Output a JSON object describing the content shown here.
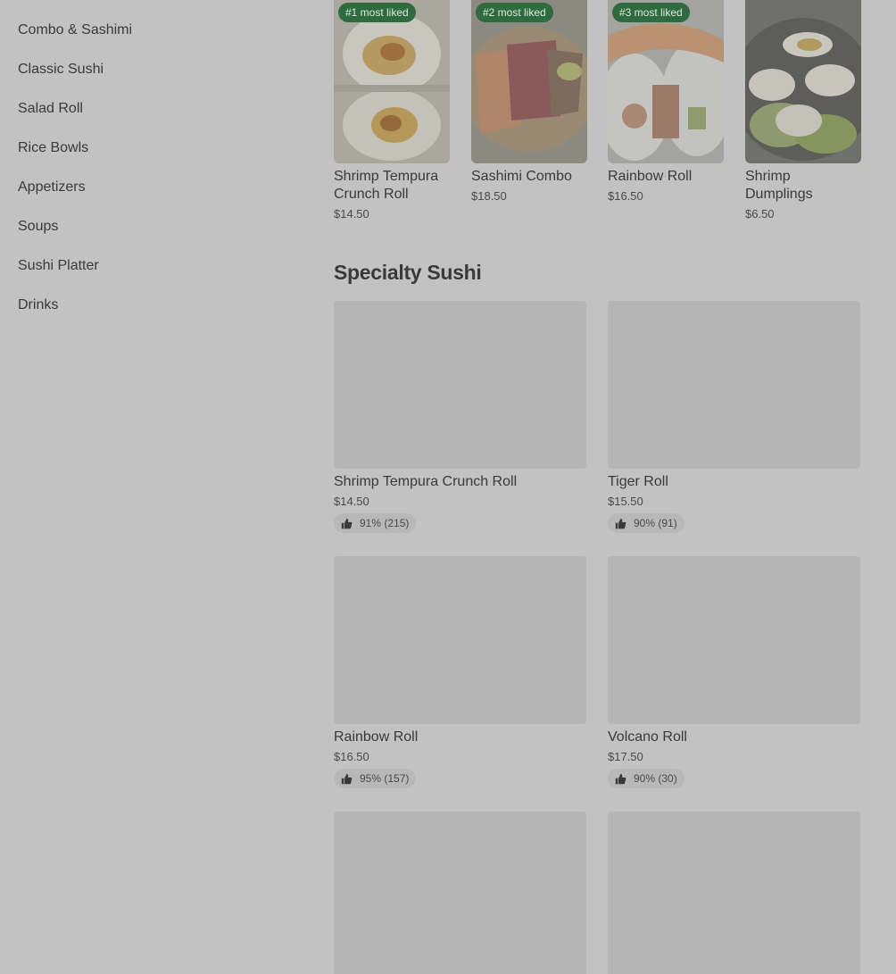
{
  "sidebar": {
    "items": [
      {
        "label": "Combo & Sashimi"
      },
      {
        "label": "Classic Sushi"
      },
      {
        "label": "Salad Roll"
      },
      {
        "label": "Rice Bowls"
      },
      {
        "label": "Appetizers"
      },
      {
        "label": "Soups"
      },
      {
        "label": "Sushi Platter"
      },
      {
        "label": "Drinks"
      }
    ]
  },
  "popular": [
    {
      "badge": "#1 most liked",
      "name": "Shrimp Tempura Crunch Roll",
      "price": "$14.50"
    },
    {
      "badge": "#2 most liked",
      "name": "Sashimi Combo",
      "price": "$18.50"
    },
    {
      "badge": "#3 most liked",
      "name": "Rainbow Roll",
      "price": "$16.50"
    },
    {
      "badge": "",
      "name": "Shrimp Dumplings",
      "price": "$6.50"
    }
  ],
  "specialty": {
    "title": "Specialty Sushi",
    "items": [
      {
        "name": "Shrimp Tempura Crunch Roll",
        "price": "$14.50",
        "rating": "91% (215)"
      },
      {
        "name": "Tiger Roll",
        "price": "$15.50",
        "rating": "90% (91)"
      },
      {
        "name": "Rainbow Roll",
        "price": "$16.50",
        "rating": "95% (157)"
      },
      {
        "name": "Volcano Roll",
        "price": "$17.50",
        "rating": "90% (30)"
      }
    ]
  },
  "colors": {
    "overlay_background": "#c2c2c2",
    "badge_green": "#2f6b3f",
    "placeholder": "#b5b5b5"
  }
}
